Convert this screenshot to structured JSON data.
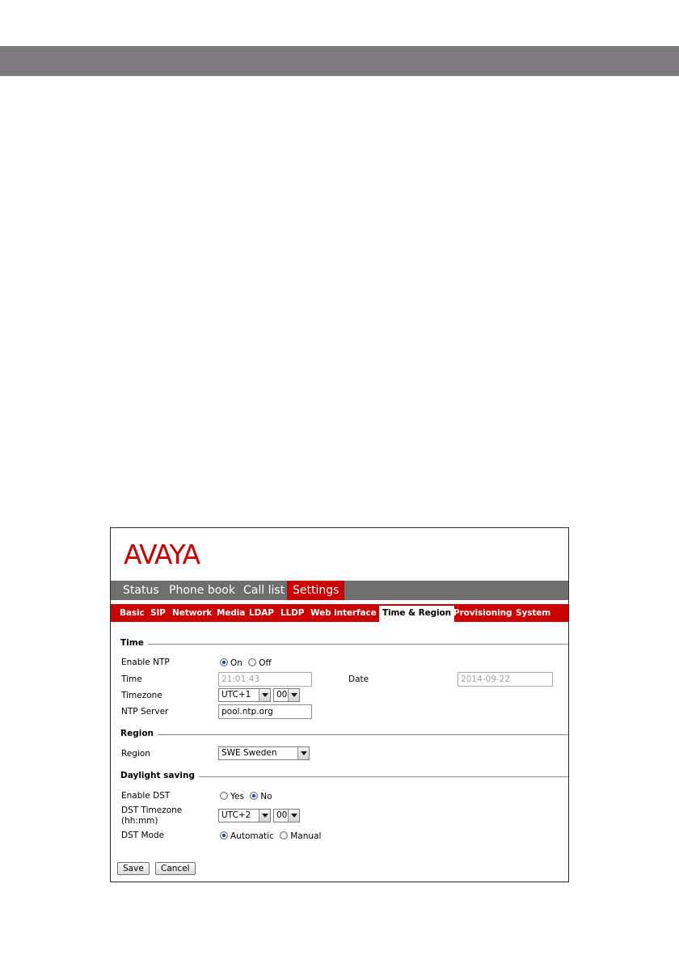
{
  "brand": {
    "logo_text": "AVAYA",
    "color": "#cc0000"
  },
  "main_nav": [
    {
      "label": "Status",
      "active": false
    },
    {
      "label": "Phone book",
      "active": false
    },
    {
      "label": "Call list",
      "active": false
    },
    {
      "label": "Settings",
      "active": true
    }
  ],
  "sub_nav": [
    {
      "label": "Basic",
      "active": false
    },
    {
      "label": "SIP",
      "active": false
    },
    {
      "label": "Network",
      "active": false
    },
    {
      "label": "Media",
      "active": false
    },
    {
      "label": "LDAP",
      "active": false
    },
    {
      "label": "LLDP",
      "active": false
    },
    {
      "label": "Web interface",
      "active": false
    },
    {
      "label": "Time & Region",
      "active": true
    },
    {
      "label": "Provisioning",
      "active": false
    },
    {
      "label": "System",
      "active": false
    }
  ],
  "time_section": {
    "title": "Time",
    "enable_ntp": {
      "label": "Enable NTP",
      "on_label": "On",
      "off_label": "Off",
      "selected": "On"
    },
    "time": {
      "label": "Time",
      "value": "21:01:43"
    },
    "date": {
      "label": "Date",
      "value": "2014-09-22"
    },
    "timezone": {
      "label": "Timezone",
      "hours": "UTC+1",
      "minutes": "00"
    },
    "ntp_server": {
      "label": "NTP Server",
      "value": "pool.ntp.org"
    }
  },
  "region_section": {
    "title": "Region",
    "region": {
      "label": "Region",
      "value": "SWE Sweden"
    }
  },
  "dst_section": {
    "title": "Daylight saving",
    "enable_dst": {
      "label": "Enable DST",
      "yes_label": "Yes",
      "no_label": "No",
      "selected": "No"
    },
    "dst_timezone": {
      "label_line1": "DST Timezone",
      "label_line2": "(hh:mm)",
      "hours": "UTC+2",
      "minutes": "00"
    },
    "dst_mode": {
      "label": "DST Mode",
      "automatic_label": "Automatic",
      "manual_label": "Manual",
      "selected": "Automatic"
    }
  },
  "buttons": {
    "save": "Save",
    "cancel": "Cancel"
  }
}
